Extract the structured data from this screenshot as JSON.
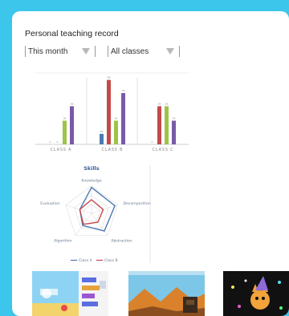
{
  "header": {
    "title": "Personal teaching record"
  },
  "filters": {
    "period": {
      "selected": "This month",
      "icon": "dropdown-arrow-icon"
    },
    "class": {
      "selected": "All classes",
      "icon": "dropdown-arrow-icon"
    }
  },
  "bar_chart": {
    "categories": [
      "CLASS A",
      "CLASS B",
      "CLASS C"
    ],
    "series_colors": [
      "#4d79b4",
      "#c44a4a",
      "#9cc447",
      "#7a59a8"
    ],
    "ylim": [
      0,
      100
    ],
    "values": [
      [
        0,
        0,
        36,
        58
      ],
      [
        16,
        98,
        36,
        78
      ],
      [
        0,
        58,
        58,
        36
      ]
    ]
  },
  "radar_chart": {
    "title": "Skills",
    "axes": [
      "Knowledge",
      "Decomposition",
      "Abstraction",
      "Algorithm",
      "Evaluation"
    ],
    "series": [
      {
        "name": "Class A",
        "color": "#4d79b4",
        "values": [
          0.95,
          0.9,
          0.8,
          0.55,
          0.45
        ]
      },
      {
        "name": "Class B",
        "color": "#c44a4a",
        "values": [
          0.5,
          0.45,
          0.4,
          0.5,
          0.45
        ]
      }
    ]
  },
  "thumbnails": [
    {
      "name": "project-thumbnail-blocks",
      "colors": [
        "#8fd3f4",
        "#f3d36b",
        "#5b6ee1"
      ]
    },
    {
      "name": "project-thumbnail-desert",
      "colors": [
        "#7cc6e8",
        "#d9822b",
        "#3a2a1e"
      ]
    },
    {
      "name": "project-thumbnail-cat",
      "colors": [
        "#111111",
        "#f2a33a",
        "#8e6bd9"
      ]
    }
  ]
}
